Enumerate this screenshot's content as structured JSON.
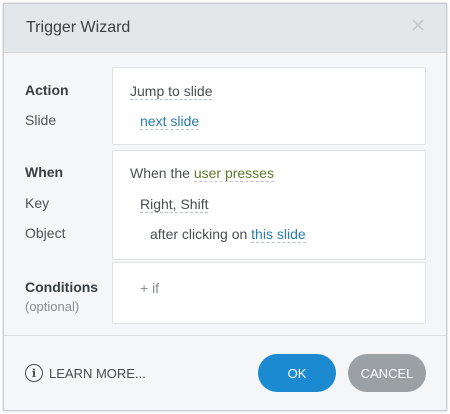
{
  "dialog": {
    "title": "Trigger Wizard",
    "close_glyph": "✕"
  },
  "action_section": {
    "action_label": "Action",
    "slide_label": "Slide",
    "action_value": "Jump to slide",
    "slide_value": "next slide"
  },
  "when_section": {
    "when_label": "When",
    "key_label": "Key",
    "object_label": "Object",
    "when_prefix": "When the",
    "when_value": "user presses",
    "key_value": "Right, Shift",
    "object_prefix": "after clicking on",
    "object_value": "this slide"
  },
  "conditions_section": {
    "conditions_label": "Conditions",
    "optional_label": "(optional)",
    "add_if": "+ if"
  },
  "footer": {
    "learn_more": "LEARN MORE...",
    "info_glyph": "i",
    "ok_label": "OK",
    "cancel_label": "CANCEL"
  },
  "icons": {
    "close": "close-icon",
    "info": "info-icon"
  },
  "colors": {
    "primary_button": "#1b8ad0",
    "secondary_button": "#9aa0a4",
    "link": "#2b7ea8",
    "link_green": "#5b7a2a"
  }
}
